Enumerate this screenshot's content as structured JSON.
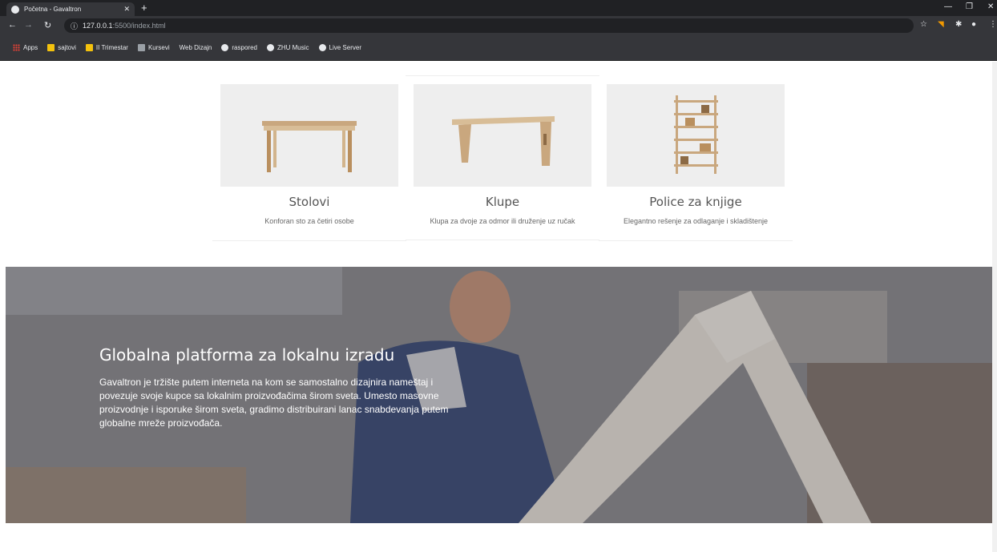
{
  "browser": {
    "tab_title": "Početna - Gavaltron",
    "url_host": "127.0.0.1",
    "url_path": ":5500/index.html",
    "bookmarks": [
      {
        "label": "Apps",
        "icon": "apps-grid-icon"
      },
      {
        "label": "sajtovi",
        "icon": "folder-icon"
      },
      {
        "label": "II Trimestar",
        "icon": "folder-icon"
      },
      {
        "label": "Kursevi",
        "icon": "document-icon"
      },
      {
        "label": "Web Dizajn",
        "icon": "none"
      },
      {
        "label": "raspored",
        "icon": "globe-icon"
      },
      {
        "label": "ZHU Music",
        "icon": "globe-icon"
      },
      {
        "label": "Live Server",
        "icon": "globe-icon"
      }
    ]
  },
  "products": [
    {
      "name": "Stolovi",
      "description": "Konforan sto za četiri osobe"
    },
    {
      "name": "Klupe",
      "description": "Klupa za dvoje za odmor ili druženje uz ručak"
    },
    {
      "name": "Police za knjige",
      "description": "Elegantno rešenje za odlaganje i skladištenje"
    }
  ],
  "hero": {
    "title": "Globalna platforma za lokalnu izradu",
    "text": "Gavaltron je tržište putem interneta na kom se samostalno dizajnira nameštaj i povezuje svoje kupce sa lokalnim proizvođačima širom sveta. Umesto masovne proizvodnje i isporuke širom sveta, gradimo distribuirani lanac snabdevanja putem globalne mreže proizvođača."
  },
  "colors": {
    "chrome_dark": "#202124",
    "chrome_toolbar": "#35363a",
    "card_image_bg": "#eeeeee",
    "wood": "#c9a77e"
  }
}
